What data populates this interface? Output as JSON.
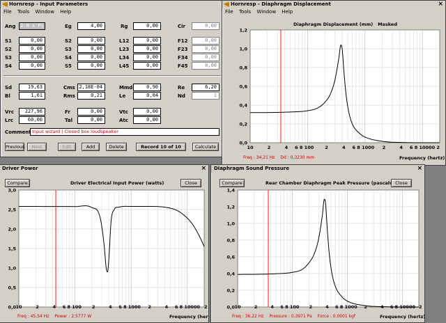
{
  "input_window": {
    "title": "Hornresp - Input Parameters",
    "menu": [
      "File",
      "Tools",
      "Window",
      "Help"
    ],
    "fields": {
      "ang_label": "Ang",
      "ang_value": "2.0 x Pi",
      "eg_label": "Eg",
      "eg_value": "4,00",
      "rg_label": "Rg",
      "rg_value": "0,00",
      "cir_label": "Cir",
      "cir_value": "0,00",
      "s1_label": "S1",
      "s1_value": "0,00",
      "s2_label": "S2",
      "s2_value": "0,00",
      "s3_label": "S3",
      "s3_value": "0,00",
      "s4_label": "S4",
      "s4_value": "0,00",
      "s2b_label": "S2",
      "s2b_value": "0,00",
      "s3b_label": "S3",
      "s3b_value": "0,00",
      "s4b_label": "S4",
      "s4b_value": "0,00",
      "s5_label": "S5",
      "s5_value": "0,00",
      "l12_label": "L12",
      "l12_value": "0,00",
      "l23_label": "L23",
      "l23_value": "0,00",
      "l34_label": "L34",
      "l34_value": "0,00",
      "l45_label": "L45",
      "l45_value": "0,00",
      "f12_label": "F12",
      "f12_value": "0,00",
      "f23_label": "F23",
      "f23_value": "0,00",
      "f34_label": "F34",
      "f34_value": "0,00",
      "f45_label": "F45",
      "f45_value": "0,00",
      "sd_label": "Sd",
      "sd_value": "19,63",
      "bl_label": "Bl",
      "bl_value": "1,61",
      "cms_label": "Cms",
      "cms_value": "2,18E-04",
      "rms_label": "Rms",
      "rms_value": "0,21",
      "mmd_label": "Mmd",
      "mmd_value": "0,90",
      "le_label": "Le",
      "le_value": "0,04",
      "re_label": "Re",
      "re_value": "6,20",
      "nd_label": "Nd",
      "nd_value": "1",
      "vrc_label": "Vrc",
      "vrc_value": "227,96",
      "lrc_label": "Lrc",
      "lrc_value": "60,00",
      "fr_label": "Fr",
      "fr_value": "0,00",
      "tal_label": "Tal",
      "tal_value": "0,00",
      "vtc_label": "Vtc",
      "vtc_value": "0,00",
      "atc_label": "Atc",
      "atc_value": "0,00"
    },
    "comment_label": "Comment",
    "comment_value": "Input wizard | Closed box loudspeaker",
    "buttons": {
      "previous": "Previous",
      "next": "Next",
      "edit": "Edit",
      "add": "Add",
      "delete": "Delete",
      "record": "Record 10 of 10",
      "calculate": "Calculate"
    }
  },
  "displacement_window": {
    "title": "Hornresp - Diaphragm Displacement",
    "menu": [
      "File",
      "Tools",
      "Window",
      "Help"
    ],
    "plot_title": "Diaphragm Displacement (mm)",
    "plot_tag": "Masked",
    "y_ticks": [
      "1,2",
      "1,0",
      "0,8",
      "0,6",
      "0,4",
      "0,2",
      "0,0"
    ],
    "x_ticks": [
      "10",
      "2",
      "4",
      "6 8 100",
      "2",
      "4",
      "6 8 1000",
      "2",
      "4",
      "6 8 10000 2"
    ],
    "x_label": "Frequency (hertz)",
    "readout": {
      "freq": "Freq : 34,21 Hz",
      "value": "Dd : 0,3230 mm"
    }
  },
  "power_window": {
    "title": "Driver Power",
    "compare": "Compare",
    "close": "Close",
    "plot_title": "Driver Electrical Input Power (watts)",
    "y_ticks": [
      "3,0",
      "2,5",
      "2,0",
      "1,5",
      "1,0",
      "0,5",
      "0,0"
    ],
    "x_ticks": [
      "10",
      "2",
      "4",
      "6 8 100",
      "2",
      "4",
      "6 8 1000",
      "2",
      "4",
      "6 8 10000",
      "2"
    ],
    "x_label": "Frequency (hertz)",
    "readout": {
      "freq": "Freq : 45,54 Hz",
      "value": "Power : 2,5777 W"
    }
  },
  "pressure_window": {
    "title": "Diaphragm Sound Pressure",
    "compare": "Compare",
    "close": "Close",
    "plot_title": "Rear Chamber Diaphragm Peak Pressure (pascals)",
    "y_ticks": [
      "1,4",
      "1,2",
      "1,0",
      "0,8",
      "0,6",
      "0,4",
      "0,2",
      "0,0"
    ],
    "x_ticks": [
      "10",
      "2",
      "4",
      "6 8 100",
      "2",
      "4",
      "6 8 1000",
      "2",
      "4",
      "6 8 10000",
      "2"
    ],
    "x_label": "Frequency (hertz)",
    "readout": {
      "freq": "Freq : 36,22 Hz",
      "value": "Pressure : 0,3971 Pa",
      "force": "Force : 0,0001 kgf"
    }
  },
  "chart_data": [
    {
      "type": "line",
      "title": "Diaphragm Displacement (mm)",
      "xlabel": "Frequency (hertz)",
      "ylabel": "",
      "x_scale": "log",
      "xlim": [
        10,
        20000
      ],
      "ylim": [
        0,
        1.2
      ],
      "x": [
        10,
        20,
        50,
        100,
        150,
        200,
        250,
        300,
        350,
        380,
        400,
        430,
        470,
        520,
        600,
        800,
        1000,
        2000,
        5000,
        20000
      ],
      "y": [
        0.32,
        0.321,
        0.327,
        0.34,
        0.37,
        0.43,
        0.52,
        0.67,
        0.9,
        1.04,
        1.0,
        0.75,
        0.5,
        0.33,
        0.2,
        0.1,
        0.06,
        0.015,
        0.002,
        0.0
      ],
      "marker_x": 34.21,
      "color": "#000000",
      "marker_color": "#ff0000"
    },
    {
      "type": "line",
      "title": "Driver Electrical Input Power (watts)",
      "xlabel": "Frequency (hertz)",
      "ylabel": "",
      "x_scale": "log",
      "xlim": [
        10,
        20000
      ],
      "ylim": [
        0,
        3.0
      ],
      "x": [
        10,
        50,
        100,
        200,
        280,
        330,
        360,
        380,
        400,
        440,
        500,
        600,
        1000,
        2000,
        4000,
        6000,
        8000,
        12000,
        16000,
        20000
      ],
      "y": [
        2.58,
        2.578,
        2.575,
        2.55,
        2.3,
        1.6,
        1.0,
        0.9,
        1.2,
        2.2,
        2.5,
        2.56,
        2.58,
        2.58,
        2.56,
        2.5,
        2.4,
        2.15,
        1.85,
        1.55
      ],
      "marker_x": 45.54,
      "color": "#000000",
      "marker_color": "#ff0000"
    },
    {
      "type": "line",
      "title": "Rear Chamber Diaphragm Peak Pressure (pascals)",
      "xlabel": "Frequency (hertz)",
      "ylabel": "",
      "x_scale": "log",
      "xlim": [
        10,
        20000
      ],
      "ylim": [
        0,
        1.4
      ],
      "x": [
        10,
        20,
        50,
        100,
        150,
        200,
        250,
        300,
        350,
        380,
        400,
        430,
        470,
        520,
        600,
        800,
        1000,
        2000,
        5000,
        20000
      ],
      "y": [
        0.39,
        0.391,
        0.398,
        0.415,
        0.45,
        0.53,
        0.64,
        0.82,
        1.1,
        1.29,
        1.24,
        0.93,
        0.62,
        0.41,
        0.25,
        0.12,
        0.07,
        0.018,
        0.003,
        0.0
      ],
      "marker_x": 36.22,
      "color": "#000000",
      "marker_color": "#ff0000"
    }
  ]
}
